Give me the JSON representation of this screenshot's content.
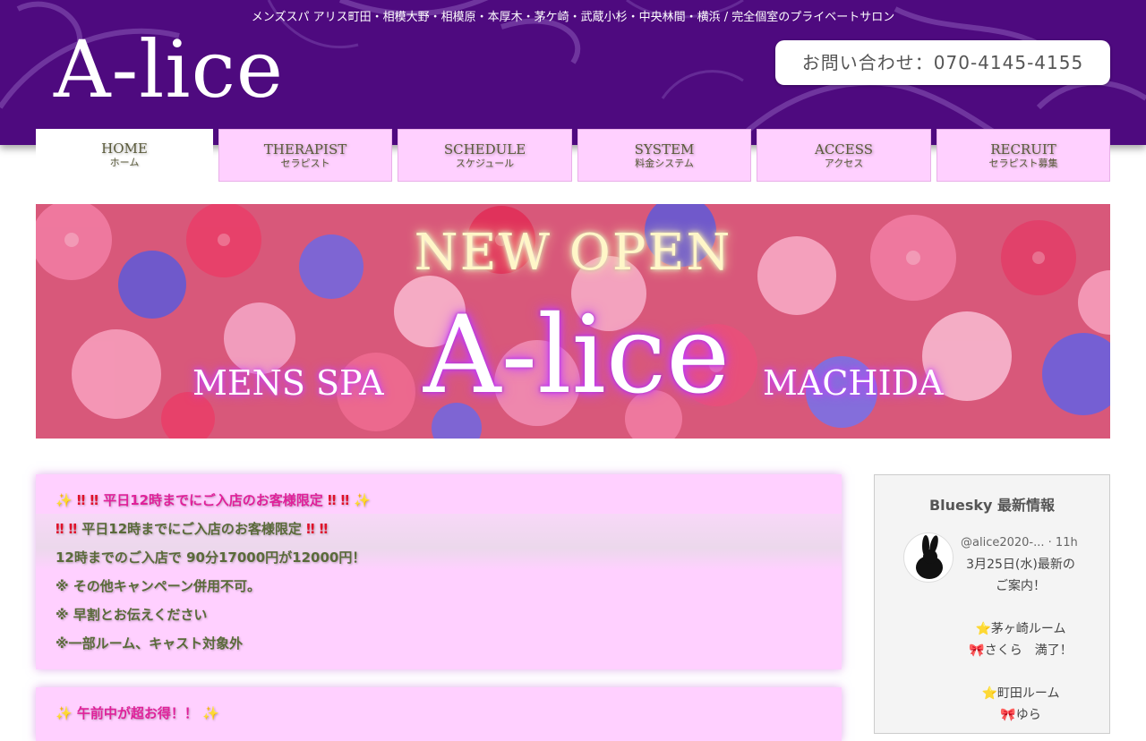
{
  "header": {
    "tagline": "メンズスパ アリス町田・相模大野・相模原・本厚木・茅ケ崎・武蔵小杉・中央林間・横浜 / 完全個室のプライベートサロン",
    "logo": "A-lice",
    "contact": "お問い合わせ：070-4145-4155",
    "bg_color": "#4e0a7f"
  },
  "nav": {
    "items": [
      {
        "en": "HOME",
        "jp": "ホーム",
        "active": true
      },
      {
        "en": "THERAPIST",
        "jp": "セラピスト",
        "active": false
      },
      {
        "en": "SCHEDULE",
        "jp": "スケジュール",
        "active": false
      },
      {
        "en": "SYSTEM",
        "jp": "料金システム",
        "active": false
      },
      {
        "en": "ACCESS",
        "jp": "アクセス",
        "active": false
      },
      {
        "en": "RECRUIT",
        "jp": "セラピスト募集",
        "active": false
      }
    ],
    "item_color": "#ffd0ff"
  },
  "banner": {
    "headline": "NEW OPEN",
    "left": "MENS  SPA",
    "brand": "A-lice",
    "right": "MACHIDA"
  },
  "campaign1": {
    "title": "平日12時までにご入店のお客様限定",
    "subtitle": "平日12時までにご入店のお客様限定",
    "line1": "12時までのご入店で 90分17000円が12000円！",
    "line2": "※ その他キャンペーン併用不可。",
    "line3": "※ 早割とお伝えください",
    "line4": "※一部ルーム、キャスト対象外"
  },
  "campaign2": {
    "title": "午前中が超お得！！"
  },
  "sidebar": {
    "title": "Bluesky 最新情報",
    "post": {
      "handle": "@alice2020-...",
      "time": "· 11h",
      "line1": "3月25日(水)最新の",
      "line2": "ご案内！",
      "room1": "茅ヶ崎ルーム",
      "cast1": "さくら　満了！",
      "room2": "町田ルーム",
      "cast2": "ゆら"
    }
  },
  "icons": {
    "sparkle": "sparkle-icon",
    "double_exclamation": "double-exclamation-icon",
    "star": "star-icon",
    "ribbon": "ribbon-icon",
    "rabbit_avatar": "rabbit-icon"
  }
}
